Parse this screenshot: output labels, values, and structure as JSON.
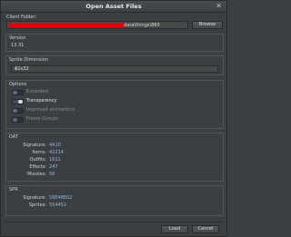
{
  "window": {
    "title": "Open Asset Files"
  },
  "client_folder": {
    "label": "Client Folder:",
    "path_value": "data\\things\\860",
    "browse_label": "Browse"
  },
  "version": {
    "title": "Version",
    "value": "13.31"
  },
  "sprite_dimension": {
    "title": "Sprite Dimension",
    "value": "32x32"
  },
  "options": {
    "title": "Options",
    "items": [
      {
        "label": "Extended",
        "on": false
      },
      {
        "label": "Transparency",
        "on": true
      },
      {
        "label": "Improved animations",
        "on": false
      },
      {
        "label": "Frame Groups",
        "on": false
      }
    ]
  },
  "dat": {
    "title": "DAT",
    "rows": [
      {
        "key": "Signature:",
        "value": "4A10"
      },
      {
        "key": "Items:",
        "value": "42214"
      },
      {
        "key": "Outfits:",
        "value": "1611"
      },
      {
        "key": "Effects:",
        "value": "247"
      },
      {
        "key": "Missiles:",
        "value": "58"
      }
    ]
  },
  "spr": {
    "title": "SPR",
    "rows": [
      {
        "key": "Signature:",
        "value": "59E48E02"
      },
      {
        "key": "Sprites:",
        "value": "554452"
      }
    ]
  },
  "footer": {
    "load_label": "Load",
    "cancel_label": "Cancel"
  },
  "icons": {
    "close": "close-icon",
    "dropdown": "chevron-down-icon"
  },
  "colors": {
    "background": "#3c3f41",
    "value_text": "#8fb6e0",
    "redaction": "#e00000"
  }
}
